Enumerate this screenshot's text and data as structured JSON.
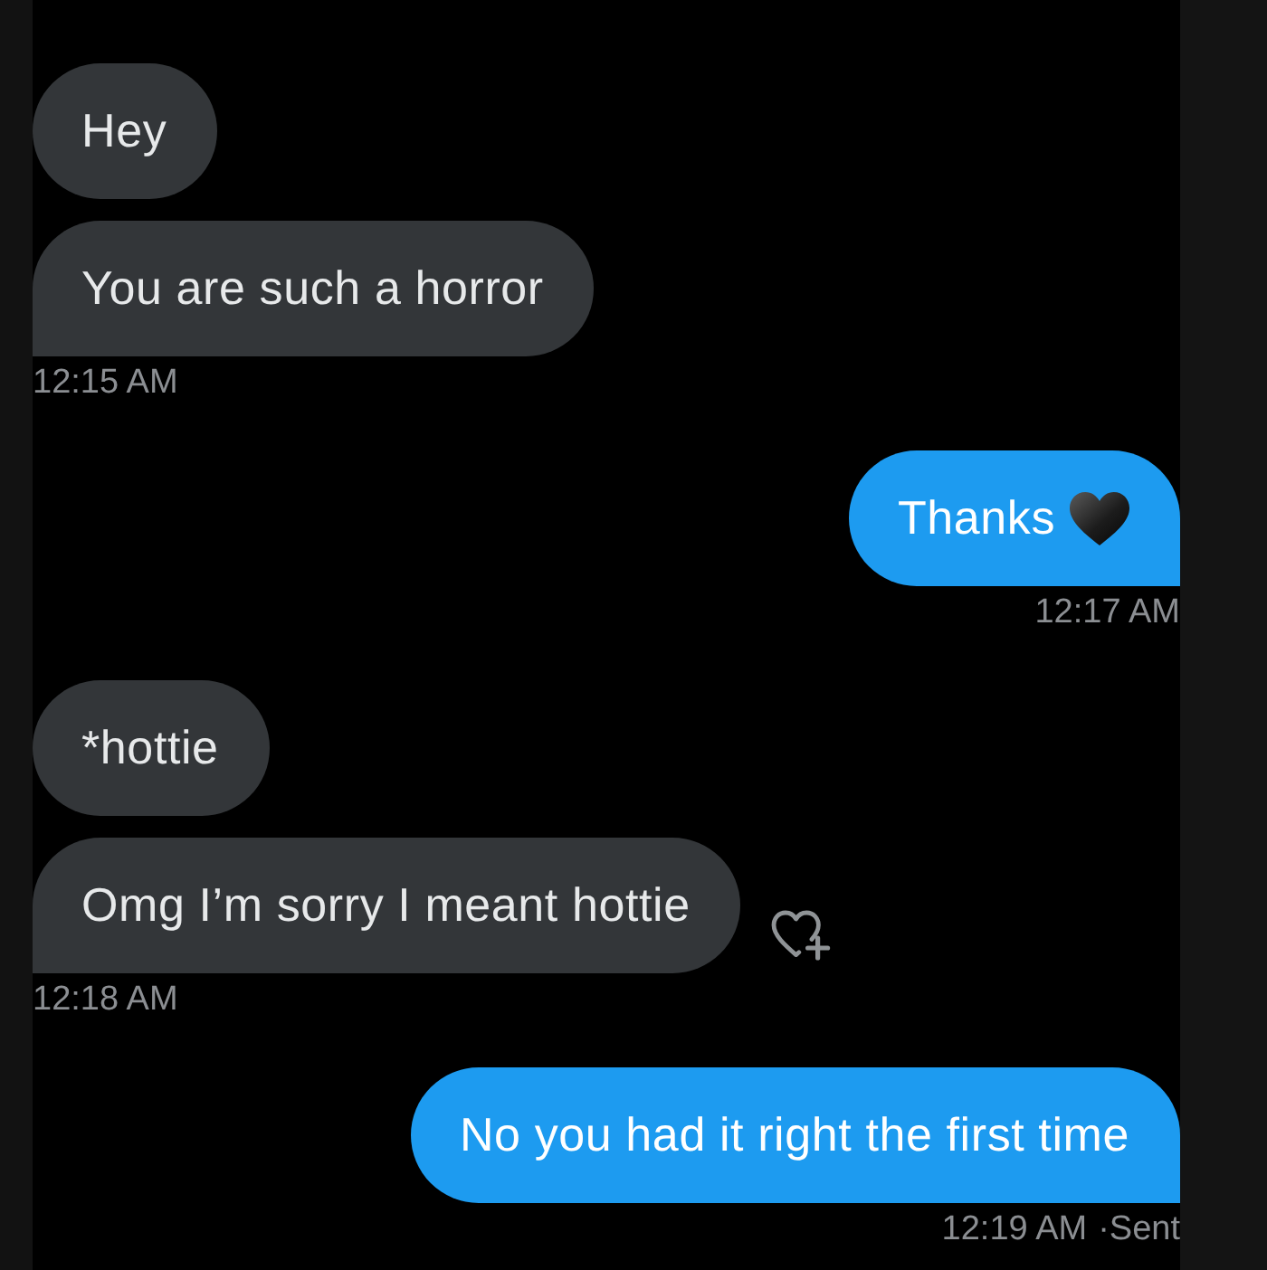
{
  "conversation": {
    "groups": [
      {
        "kind": "received",
        "messages": [
          {
            "text": "Hey",
            "heart_emoji": false,
            "react_button": false
          },
          {
            "text": "You are such a horror",
            "heart_emoji": false,
            "react_button": false
          }
        ],
        "time": "12:15 AM"
      },
      {
        "kind": "sent",
        "messages": [
          {
            "text": "Thanks",
            "heart_emoji": true,
            "react_button": false
          }
        ],
        "time": "12:17 AM"
      },
      {
        "kind": "received",
        "messages": [
          {
            "text": "*hottie",
            "heart_emoji": false,
            "react_button": false
          },
          {
            "text": "Omg I’m sorry I meant hottie",
            "heart_emoji": false,
            "react_button": true
          }
        ],
        "time": "12:18 AM"
      },
      {
        "kind": "sent",
        "messages": [
          {
            "text": "No you had it right the first time",
            "heart_emoji": false,
            "react_button": false
          }
        ],
        "time": "12:19 AM",
        "status": "·Sent"
      }
    ]
  }
}
